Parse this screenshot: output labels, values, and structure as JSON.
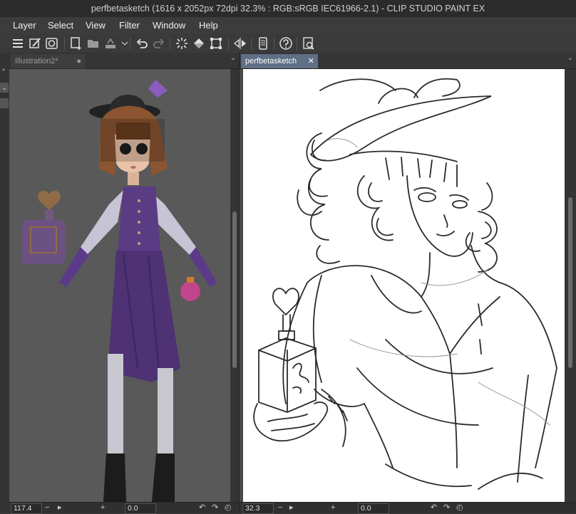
{
  "window": {
    "title": "perfbetasketch (1616 x 2052px 72dpi 32.3% : RGB:sRGB IEC61966-2.1)  - CLIP STUDIO PAINT EX"
  },
  "menu": {
    "items": [
      "Layer",
      "Select",
      "View",
      "Filter",
      "Window",
      "Help"
    ]
  },
  "tabs": {
    "left": {
      "label": "Illustration2*",
      "marker": "●"
    },
    "right": {
      "label": "perfbetasketch",
      "close": "✕"
    }
  },
  "status": {
    "left": {
      "zoom": "117.4",
      "angle": "0.0"
    },
    "right": {
      "zoom": "32.3",
      "angle": "0.0"
    },
    "glyphs": {
      "minus": "−",
      "plus": "+",
      "rotate_left": "↶",
      "rotate_right": "↷"
    }
  },
  "icons": [
    "hamburger-menu-icon",
    "new-icon",
    "open-icon",
    "save-icon",
    "undo-icon",
    "redo-icon",
    "transform-icon",
    "fill-icon",
    "crop-icon",
    "flip-icon",
    "device-icon",
    "help-icon",
    "search-icon"
  ],
  "colors": {
    "tab_active": "#5f6f86",
    "title_bg": "#2b2b2b",
    "panel_bg": "#3a3a3a"
  }
}
